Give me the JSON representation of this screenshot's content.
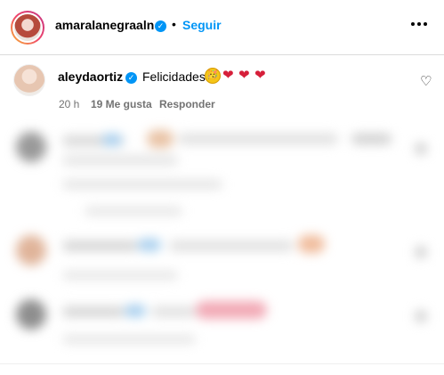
{
  "header": {
    "username": "amaralanegraaln",
    "separator": "•",
    "follow_label": "Seguir"
  },
  "comment": {
    "username": "aleydaortiz",
    "text": "Felicidades",
    "emoji_face": "🥳",
    "hearts": [
      "❤",
      "❤",
      "❤"
    ],
    "time": "20 h",
    "likes": "19 Me gusta",
    "reply_label": "Responder",
    "like_icon": "♡"
  },
  "colors": {
    "accent": "#0095f6",
    "muted": "#737373",
    "divider": "#dbdbdb"
  },
  "icons": {
    "verified": "verified-badge-icon",
    "more": "more-options-icon",
    "like": "heart-outline-icon"
  }
}
